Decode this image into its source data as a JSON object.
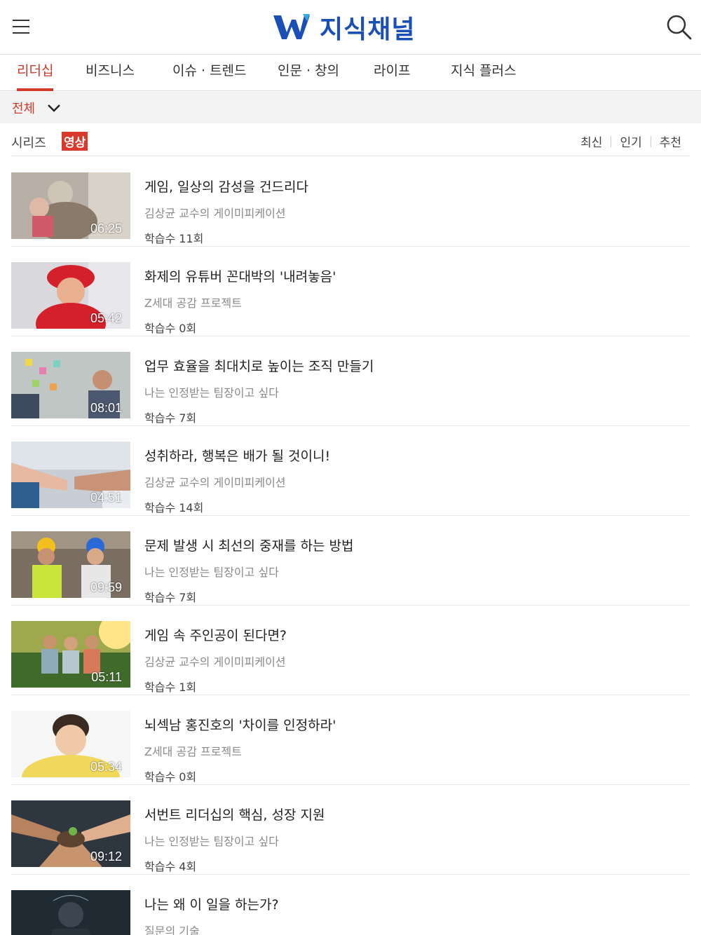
{
  "header": {
    "logo_text": "지식채널",
    "brand_color": "#1a4fb8"
  },
  "tabs": [
    {
      "label": "리더십",
      "active": true
    },
    {
      "label": "비즈니스"
    },
    {
      "label": "이슈 · 트렌드"
    },
    {
      "label": "인문 · 창의"
    },
    {
      "label": "라이프"
    },
    {
      "label": "지식 플러스"
    }
  ],
  "filter": {
    "label": "전체"
  },
  "subtabs": {
    "series": "시리즈",
    "video": "영상"
  },
  "sort": [
    "최신",
    "인기",
    "추천"
  ],
  "accent_color": "#d23a2c",
  "items": [
    {
      "title": "게임, 일상의 감성을 건드리다",
      "subtitle": "김상균 교수의 게이미피케이션",
      "count": "학습수 11회",
      "duration": "06:25"
    },
    {
      "title": "화제의 유튜버 꼰대박의 '내려놓음'",
      "subtitle": "Z세대 공감 프로젝트",
      "count": "학습수 0회",
      "duration": "05:42"
    },
    {
      "title": "업무 효율을 최대치로 높이는 조직 만들기",
      "subtitle": "나는 인정받는 팀장이고 싶다",
      "count": "학습수 7회",
      "duration": "08:01"
    },
    {
      "title": "성취하라, 행복은 배가 될 것이니!",
      "subtitle": "김상균 교수의 게이미피케이션",
      "count": "학습수 14회",
      "duration": "04:51"
    },
    {
      "title": "문제 발생 시 최선의 중재를 하는 방법",
      "subtitle": "나는 인정받는 팀장이고 싶다",
      "count": "학습수 7회",
      "duration": "09:59"
    },
    {
      "title": "게임 속 주인공이 된다면?",
      "subtitle": "김상균 교수의 게이미피케이션",
      "count": "학습수 1회",
      "duration": "05:11"
    },
    {
      "title": "뇌섹남 홍진호의 '차이를 인정하라'",
      "subtitle": "Z세대 공감 프로젝트",
      "count": "학습수 0회",
      "duration": "05:34"
    },
    {
      "title": "서번트 리더십의 핵심, 성장 지원",
      "subtitle": "나는 인정받는 팀장이고 싶다",
      "count": "학습수 4회",
      "duration": "09:12"
    },
    {
      "title": "나는 왜 이 일을 하는가?",
      "subtitle": "질문의 기술",
      "count": "",
      "duration": ""
    }
  ]
}
